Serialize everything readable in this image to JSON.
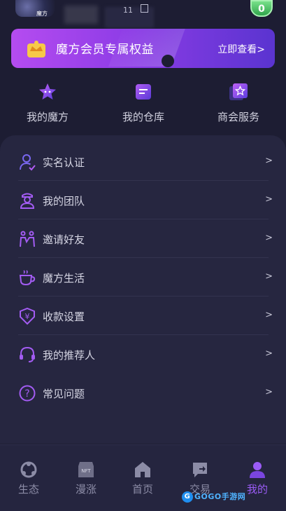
{
  "header": {
    "avatar_label": "魔方",
    "status_number": "11",
    "level_badge": "0"
  },
  "vip_banner": {
    "title": "魔方会员专属权益",
    "link_label": "立即查看>"
  },
  "quick_actions": [
    {
      "label": "我的魔方",
      "icon": "star-cube-icon"
    },
    {
      "label": "我的仓库",
      "icon": "warehouse-icon"
    },
    {
      "label": "商会服务",
      "icon": "service-star-icon"
    }
  ],
  "menu": [
    {
      "label": "实名认证",
      "icon": "user-verify-icon",
      "arrow": ">"
    },
    {
      "label": "我的团队",
      "icon": "team-icon",
      "arrow": ">"
    },
    {
      "label": "邀请好友",
      "icon": "invite-friends-icon",
      "arrow": ">"
    },
    {
      "label": "魔方生活",
      "icon": "coffee-cup-icon",
      "arrow": ">"
    },
    {
      "label": "收款设置",
      "icon": "yuan-payment-icon",
      "arrow": ">"
    },
    {
      "label": "我的推荐人",
      "icon": "headset-icon",
      "arrow": ">"
    },
    {
      "label": "常见问题",
      "icon": "question-icon",
      "arrow": ">"
    }
  ],
  "tabbar": [
    {
      "label": "生态",
      "icon": "ecology-icon",
      "active": false
    },
    {
      "label": "漫涨",
      "icon": "nft-icon",
      "active": false
    },
    {
      "label": "首页",
      "icon": "home-icon",
      "active": false
    },
    {
      "label": "交易",
      "icon": "trade-icon",
      "active": false
    },
    {
      "label": "我的",
      "icon": "profile-icon",
      "active": true
    }
  ],
  "watermark": {
    "text": "GOGO手游网",
    "logo_letter": "G"
  },
  "colors": {
    "accent": "#9b5cf6",
    "banner_start": "#b54cf0",
    "banner_end": "#5a34d0",
    "background": "#1d1d33",
    "card": "#262640",
    "level_badge": "#2fa44b"
  }
}
